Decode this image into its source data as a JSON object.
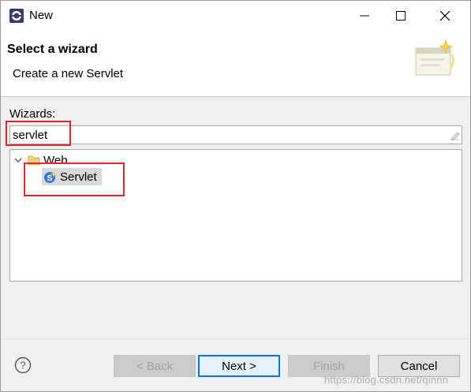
{
  "window": {
    "title": "New"
  },
  "banner": {
    "title": "Select a wizard",
    "description": "Create a new Servlet"
  },
  "filter": {
    "label": "Wizards:",
    "value": "servlet"
  },
  "tree": {
    "category": "Web",
    "item": "Servlet"
  },
  "buttons": {
    "back": "< Back",
    "next": "Next >",
    "finish": "Finish",
    "cancel": "Cancel"
  },
  "watermark": "https://blog.csdn.net/qinnn",
  "colors": {
    "annotation": "#e0252a",
    "default_button": "#0078d7"
  },
  "icons": [
    "eclipse-icon",
    "minimize-icon",
    "maximize-icon",
    "close-icon",
    "wizard-banner-icon",
    "clear-filter-icon",
    "chevron-down-icon",
    "folder-icon",
    "servlet-icon",
    "help-icon"
  ]
}
